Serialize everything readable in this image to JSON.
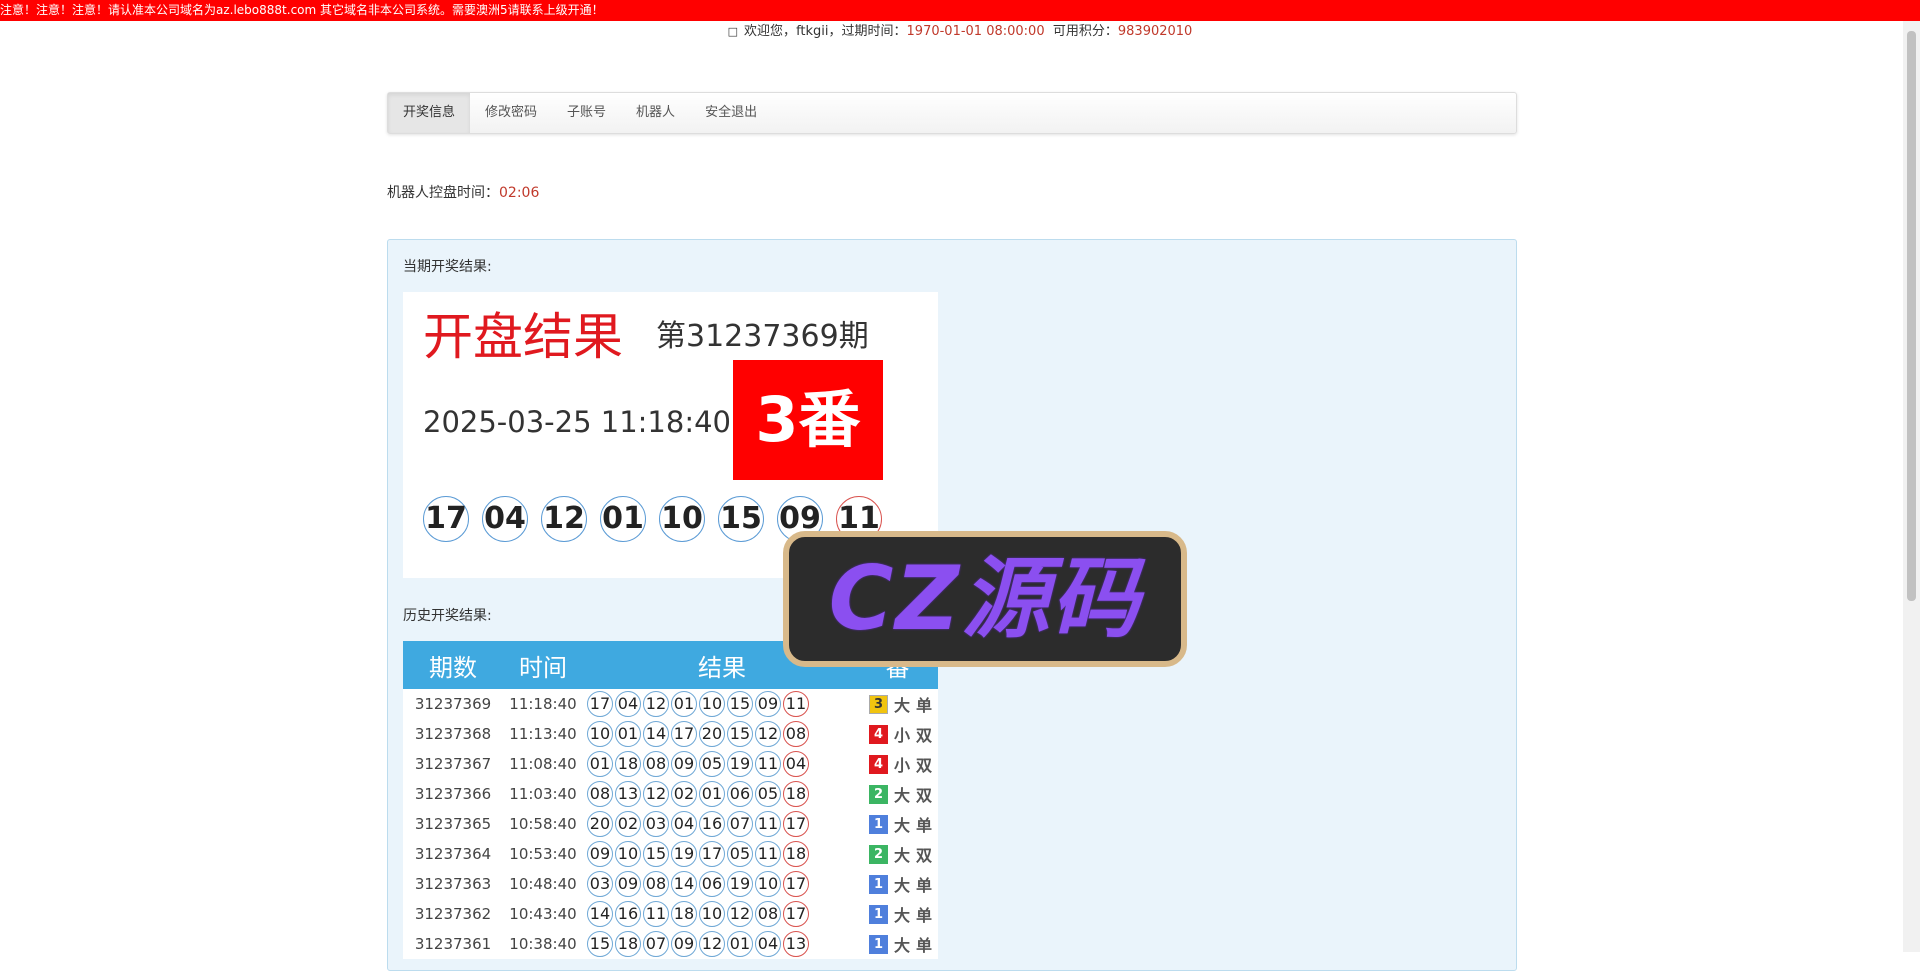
{
  "notice": "注意！注意！注意！请认准本公司域名为az.lebo888t.com 其它域名非本公司系统。需要澳洲5请联系上级开通！",
  "header": {
    "icon": "user-icon",
    "welcome_prefix": "欢迎您，",
    "username": "ftkgii",
    "expire_label": "，过期时间：",
    "expire_value": "1970-01-01 08:00:00",
    "points_label": "可用积分：",
    "points_value": "983902010"
  },
  "nav": {
    "items": [
      {
        "label": "开奖信息",
        "active": true
      },
      {
        "label": "修改密码"
      },
      {
        "label": "子账号"
      },
      {
        "label": "机器人"
      },
      {
        "label": "安全退出"
      }
    ]
  },
  "robot": {
    "label": "机器人控盘时间：",
    "value": "02:06"
  },
  "current": {
    "section_label": "当期开奖结果:",
    "title": "开盘结果",
    "issue": "第31237369期",
    "datetime": "2025-03-25 11:18:40",
    "badge": "3番",
    "balls": [
      "17",
      "04",
      "12",
      "01",
      "10",
      "15",
      "09",
      "11"
    ]
  },
  "history": {
    "section_label": "历史开奖结果:",
    "headers": [
      "期数",
      "时间",
      "结果",
      "番"
    ],
    "rows": [
      {
        "id": "31237369",
        "time": "11:18:40",
        "balls": [
          "17",
          "04",
          "12",
          "01",
          "10",
          "15",
          "09",
          "11"
        ],
        "fan": "3",
        "size": "大",
        "parity": "单"
      },
      {
        "id": "31237368",
        "time": "11:13:40",
        "balls": [
          "10",
          "01",
          "14",
          "17",
          "20",
          "15",
          "12",
          "08"
        ],
        "fan": "4",
        "size": "小",
        "parity": "双"
      },
      {
        "id": "31237367",
        "time": "11:08:40",
        "balls": [
          "01",
          "18",
          "08",
          "09",
          "05",
          "19",
          "11",
          "04"
        ],
        "fan": "4",
        "size": "小",
        "parity": "双"
      },
      {
        "id": "31237366",
        "time": "11:03:40",
        "balls": [
          "08",
          "13",
          "12",
          "02",
          "01",
          "06",
          "05",
          "18"
        ],
        "fan": "2",
        "size": "大",
        "parity": "双"
      },
      {
        "id": "31237365",
        "time": "10:58:40",
        "balls": [
          "20",
          "02",
          "03",
          "04",
          "16",
          "07",
          "11",
          "17"
        ],
        "fan": "1",
        "size": "大",
        "parity": "单"
      },
      {
        "id": "31237364",
        "time": "10:53:40",
        "balls": [
          "09",
          "10",
          "15",
          "19",
          "17",
          "05",
          "11",
          "18"
        ],
        "fan": "2",
        "size": "大",
        "parity": "双"
      },
      {
        "id": "31237363",
        "time": "10:48:40",
        "balls": [
          "03",
          "09",
          "08",
          "14",
          "06",
          "19",
          "10",
          "17"
        ],
        "fan": "1",
        "size": "大",
        "parity": "单"
      },
      {
        "id": "31237362",
        "time": "10:43:40",
        "balls": [
          "14",
          "16",
          "11",
          "18",
          "10",
          "12",
          "08",
          "17"
        ],
        "fan": "1",
        "size": "大",
        "parity": "单"
      },
      {
        "id": "31237361",
        "time": "10:38:40",
        "balls": [
          "15",
          "18",
          "07",
          "09",
          "12",
          "01",
          "04",
          "13"
        ],
        "fan": "1",
        "size": "大",
        "parity": "单"
      }
    ]
  },
  "watermark": {
    "text": "CZ源码"
  },
  "colors": {
    "notice_bg": "#ff0000",
    "title_red": "#e0191f",
    "table_header": "#3fa9e0",
    "panel_bg": "#eaf4fb",
    "fan1": "#4f7fdc",
    "fan2": "#3bb563",
    "fan3": "#f1c40f",
    "fan4": "#e0191f"
  }
}
